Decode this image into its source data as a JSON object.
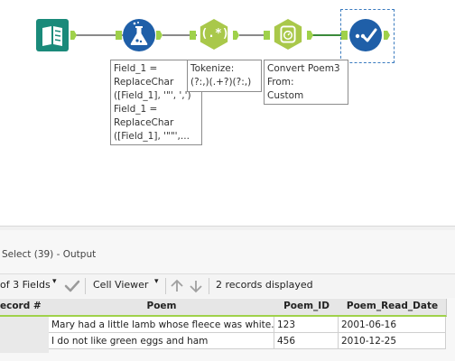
{
  "canvas": {
    "annotations": {
      "formula": "Field_1 =\nReplaceChar\n([Field_1], '\"', ',')\nField_1 =\nReplaceChar\n([Field_1], '\"\"',...",
      "regex": "Tokenize:\n(?:,)(.+?)(?:,)",
      "datetime": "Convert Poem3\nFrom:\nCustom"
    },
    "tools": {
      "input_icon": "book-icon",
      "formula_icon": "flask-icon",
      "regex_icon": "regex-icon",
      "datetime_icon": "clock-icon",
      "select_icon": "checkmark-icon"
    },
    "regex_label": "(.*)"
  },
  "results": {
    "title": "Select (39) - Output",
    "toolbar": {
      "fields_label": "of 3 Fields",
      "viewer_label": "Cell Viewer",
      "records_label": "2 records displayed"
    },
    "columns": [
      "ecord #",
      "Poem",
      "Poem_ID",
      "Poem_Read_Date"
    ],
    "rows": [
      [
        "",
        "Mary had a little lamb whose fleece was white...",
        "123",
        "2001-06-16"
      ],
      [
        "",
        "I do not like green eggs and ham",
        "456",
        "2010-12-25"
      ]
    ]
  },
  "colors": {
    "teal": "#1a8a7a",
    "blue": "#1f5fa8",
    "green": "#9fd14a",
    "lime": "#a9c84a"
  }
}
